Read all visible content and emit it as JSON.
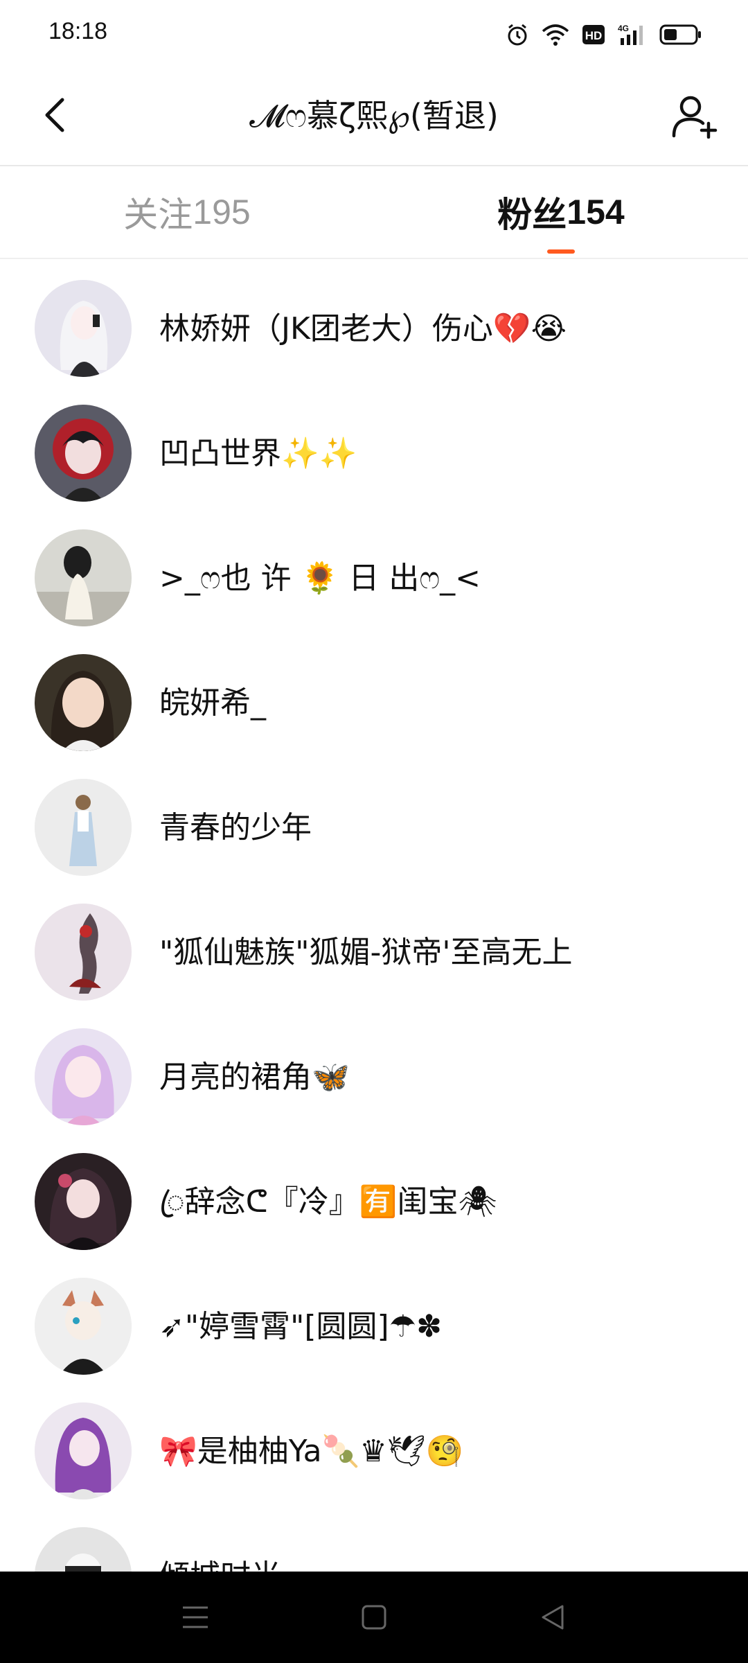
{
  "status_bar": {
    "time": "18:18",
    "icons": [
      "alarm-icon",
      "wifi-icon",
      "hd-icon",
      "signal-4g-icon",
      "battery-icon"
    ],
    "hd_label": "HD",
    "network_label": "4G"
  },
  "header": {
    "title": "𝓜ෆ慕ζ熙℘(暂退)",
    "back_icon": "chevron-left-icon",
    "add_icon": "add-user-icon"
  },
  "tabs": [
    {
      "label": "关注",
      "count": "195",
      "active": false
    },
    {
      "label": "粉丝",
      "count": "154",
      "active": true
    }
  ],
  "colors": {
    "accent": "#ff5a1f",
    "inactive_tab": "#9a9a9a",
    "text": "#111111",
    "nav_bar": "#000000"
  },
  "fans": [
    {
      "name": "林娇妍（JK团老大）伤心💔😭"
    },
    {
      "name": "凹凸世界✨✨"
    },
    {
      "name": ">_ෆ也 许 🌻 日 出ෆ_<"
    },
    {
      "name": "皖妍希_"
    },
    {
      "name": "青春的少年"
    },
    {
      "name": "\"狐仙魅族\"狐媚-狱帝'至高无上"
    },
    {
      "name": "月亮的裙角🦋"
    },
    {
      "name": "ꦿ辞念ᕦ『冷』🈶闺宝🕷"
    },
    {
      "name": "➶\"婷雪霄\"[圆圆]☂✽"
    },
    {
      "name": "🎀是柚柚Ya🍡♛🕊🧐"
    },
    {
      "name": "倾城时光"
    }
  ],
  "nav_bar": {
    "icons": [
      "menu-icon",
      "home-square-icon",
      "back-triangle-icon"
    ]
  }
}
